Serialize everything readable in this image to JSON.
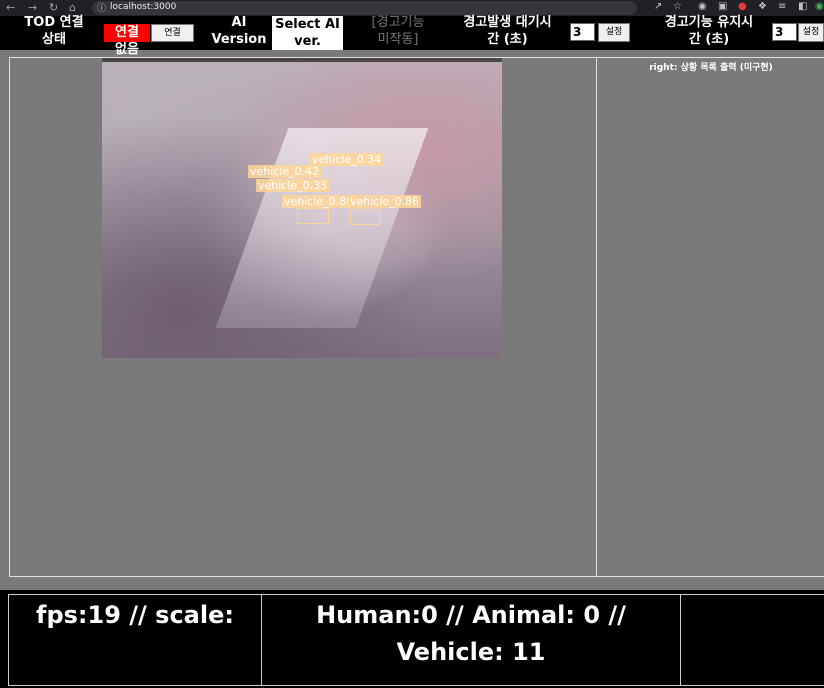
{
  "browser": {
    "url": "localhost:3000"
  },
  "topbar": {
    "tod_status_label": "TOD 연결\n상태",
    "connection_state": "연결\n없음",
    "connect_button": "연결",
    "ai_version_label": "AI\nVersion",
    "select_ai_button": "Select AI\nver.",
    "alarm_state": "[경고기능\n미작동]",
    "alarm_wait_label": "경고발생 대기시\n간 (초)",
    "alarm_wait_value": "3",
    "alarm_wait_set": "설정",
    "alarm_hold_label": "경고기능 유지시\n간 (초)",
    "alarm_hold_value": "3",
    "alarm_hold_set": "설정",
    "colors": {
      "status_red": "#ff0000"
    }
  },
  "video": {
    "detections": [
      "vehicle_0.34",
      "vehicle_0.42",
      "vehicle_0.33",
      "vehicle_0.80",
      "vehicle_0.86"
    ]
  },
  "right_panel": {
    "caption": "right: 상황 목록 출력 (미구현)"
  },
  "bottom": {
    "fps_text": "fps:19 // scale:",
    "counts_text": "Human:0 // Animal: 0 //\nVehicle: 11",
    "extra_text": ""
  }
}
